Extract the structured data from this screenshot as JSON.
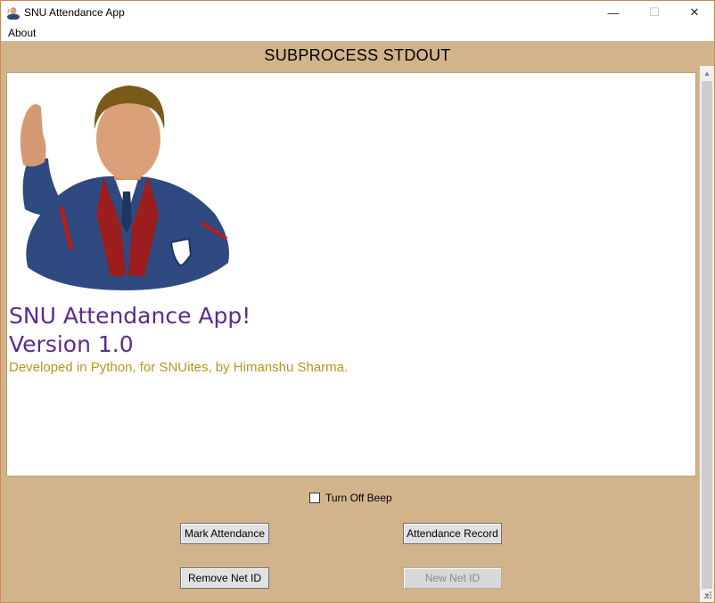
{
  "window": {
    "title": "SNU Attendance App",
    "min_glyph": "—",
    "max_glyph": "☐",
    "close_glyph": "✕",
    "app_icon": "person-icon"
  },
  "menu": {
    "about": "About"
  },
  "stdout": {
    "title": "SUBPROCESS STDOUT",
    "avatar_icon": "waving-person-avatar",
    "app_name": "SNU Attendance App!",
    "version": "Version 1.0",
    "credit": "Developed in Python, for SNUites, by Himanshu Sharma."
  },
  "options": {
    "beep_label": "Turn Off Beep",
    "beep_checked": false
  },
  "buttons": {
    "mark_attendance": "Mark Attendance",
    "attendance_record": "Attendance Record",
    "remove_net_id": "Remove Net ID",
    "new_net_id": "New Net ID"
  },
  "colors": {
    "client_background": "#d2b48c",
    "app_name_text": "#5b2c8e",
    "credit_text": "#b8961e"
  }
}
